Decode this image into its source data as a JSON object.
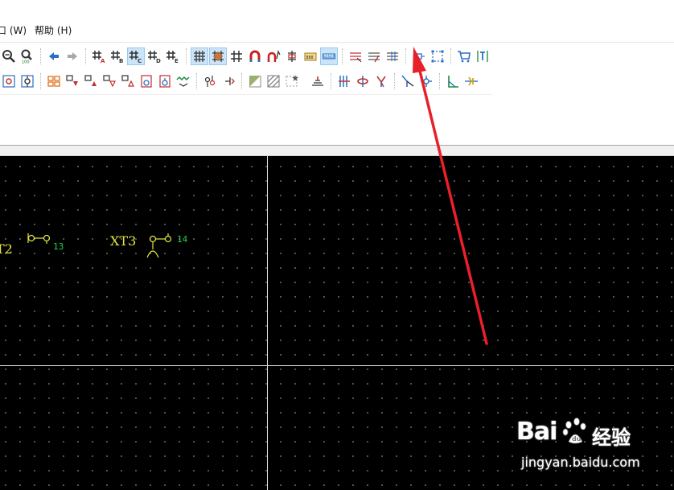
{
  "menu": {
    "window": "口 (W)",
    "help": "帮助 (H)"
  },
  "toolbar1": [
    {
      "icon": "zoom-out-icon"
    },
    {
      "icon": "zoom-100-icon"
    },
    {
      "icon": "back-arrow-icon"
    },
    {
      "icon": "forward-arrow-icon"
    },
    {
      "icon": "grid-a-icon"
    },
    {
      "icon": "grid-b-icon"
    },
    {
      "icon": "grid-c-icon",
      "pressed": true
    },
    {
      "icon": "grid-d-icon"
    },
    {
      "icon": "grid-e-icon"
    },
    {
      "icon": "grid-snap-icon",
      "pressed": true
    },
    {
      "icon": "grid-star-icon",
      "pressed": true
    },
    {
      "icon": "crosshair-icon"
    },
    {
      "icon": "magnet-icon"
    },
    {
      "icon": "magnet-arrow-icon"
    },
    {
      "icon": "align-icon"
    },
    {
      "icon": "display-icon"
    },
    {
      "icon": "ruler-icon",
      "pressed": true
    },
    {
      "icon": "lines-1-icon"
    },
    {
      "icon": "lines-2-icon"
    },
    {
      "icon": "lines-3-icon"
    },
    {
      "icon": "small-square-icon"
    },
    {
      "icon": "select-frame-icon"
    },
    {
      "icon": "cart-icon"
    },
    {
      "icon": "text-cursor-icon"
    }
  ],
  "toolbar2": [
    {
      "icon": "copy-node-icon"
    },
    {
      "icon": "node-updown-icon"
    },
    {
      "icon": "symbol-1-icon"
    },
    {
      "icon": "symbol-2-icon"
    },
    {
      "icon": "symbol-3-icon"
    },
    {
      "icon": "symbol-4-icon"
    },
    {
      "icon": "symbol-5-icon"
    },
    {
      "icon": "symbol-6-icon"
    },
    {
      "icon": "symbol-7-icon"
    },
    {
      "icon": "wave-icon"
    },
    {
      "icon": "terminal-1-icon"
    },
    {
      "icon": "terminal-2-icon"
    },
    {
      "icon": "hatch-1-icon"
    },
    {
      "icon": "hatch-2-icon"
    },
    {
      "icon": "dash-box-icon"
    },
    {
      "icon": "stack-icon"
    },
    {
      "icon": "vert-lines-icon"
    },
    {
      "icon": "cross-red-icon"
    },
    {
      "icon": "branch-icon"
    },
    {
      "icon": "pointer-wire-icon"
    },
    {
      "icon": "node-blue-icon"
    },
    {
      "icon": "branch-green-icon"
    },
    {
      "icon": "plug-icon"
    }
  ],
  "canvas": {
    "labels": [
      {
        "id": "xt2",
        "text": "T2"
      },
      {
        "id": "xt3",
        "text": "XT3"
      }
    ],
    "numbers": [
      {
        "id": "n13",
        "text": "13"
      },
      {
        "id": "n14",
        "text": "14"
      }
    ],
    "colors": {
      "label": "#e6e642",
      "number": "#22d24a",
      "background": "#000000",
      "axis": "#e6e6e6"
    }
  },
  "annotation": {
    "color": "#e8202a"
  },
  "watermark": {
    "brand_bai": "Bai",
    "brand_du": "du",
    "brand_cn": "经验",
    "url": "jingyan.baidu.com"
  }
}
